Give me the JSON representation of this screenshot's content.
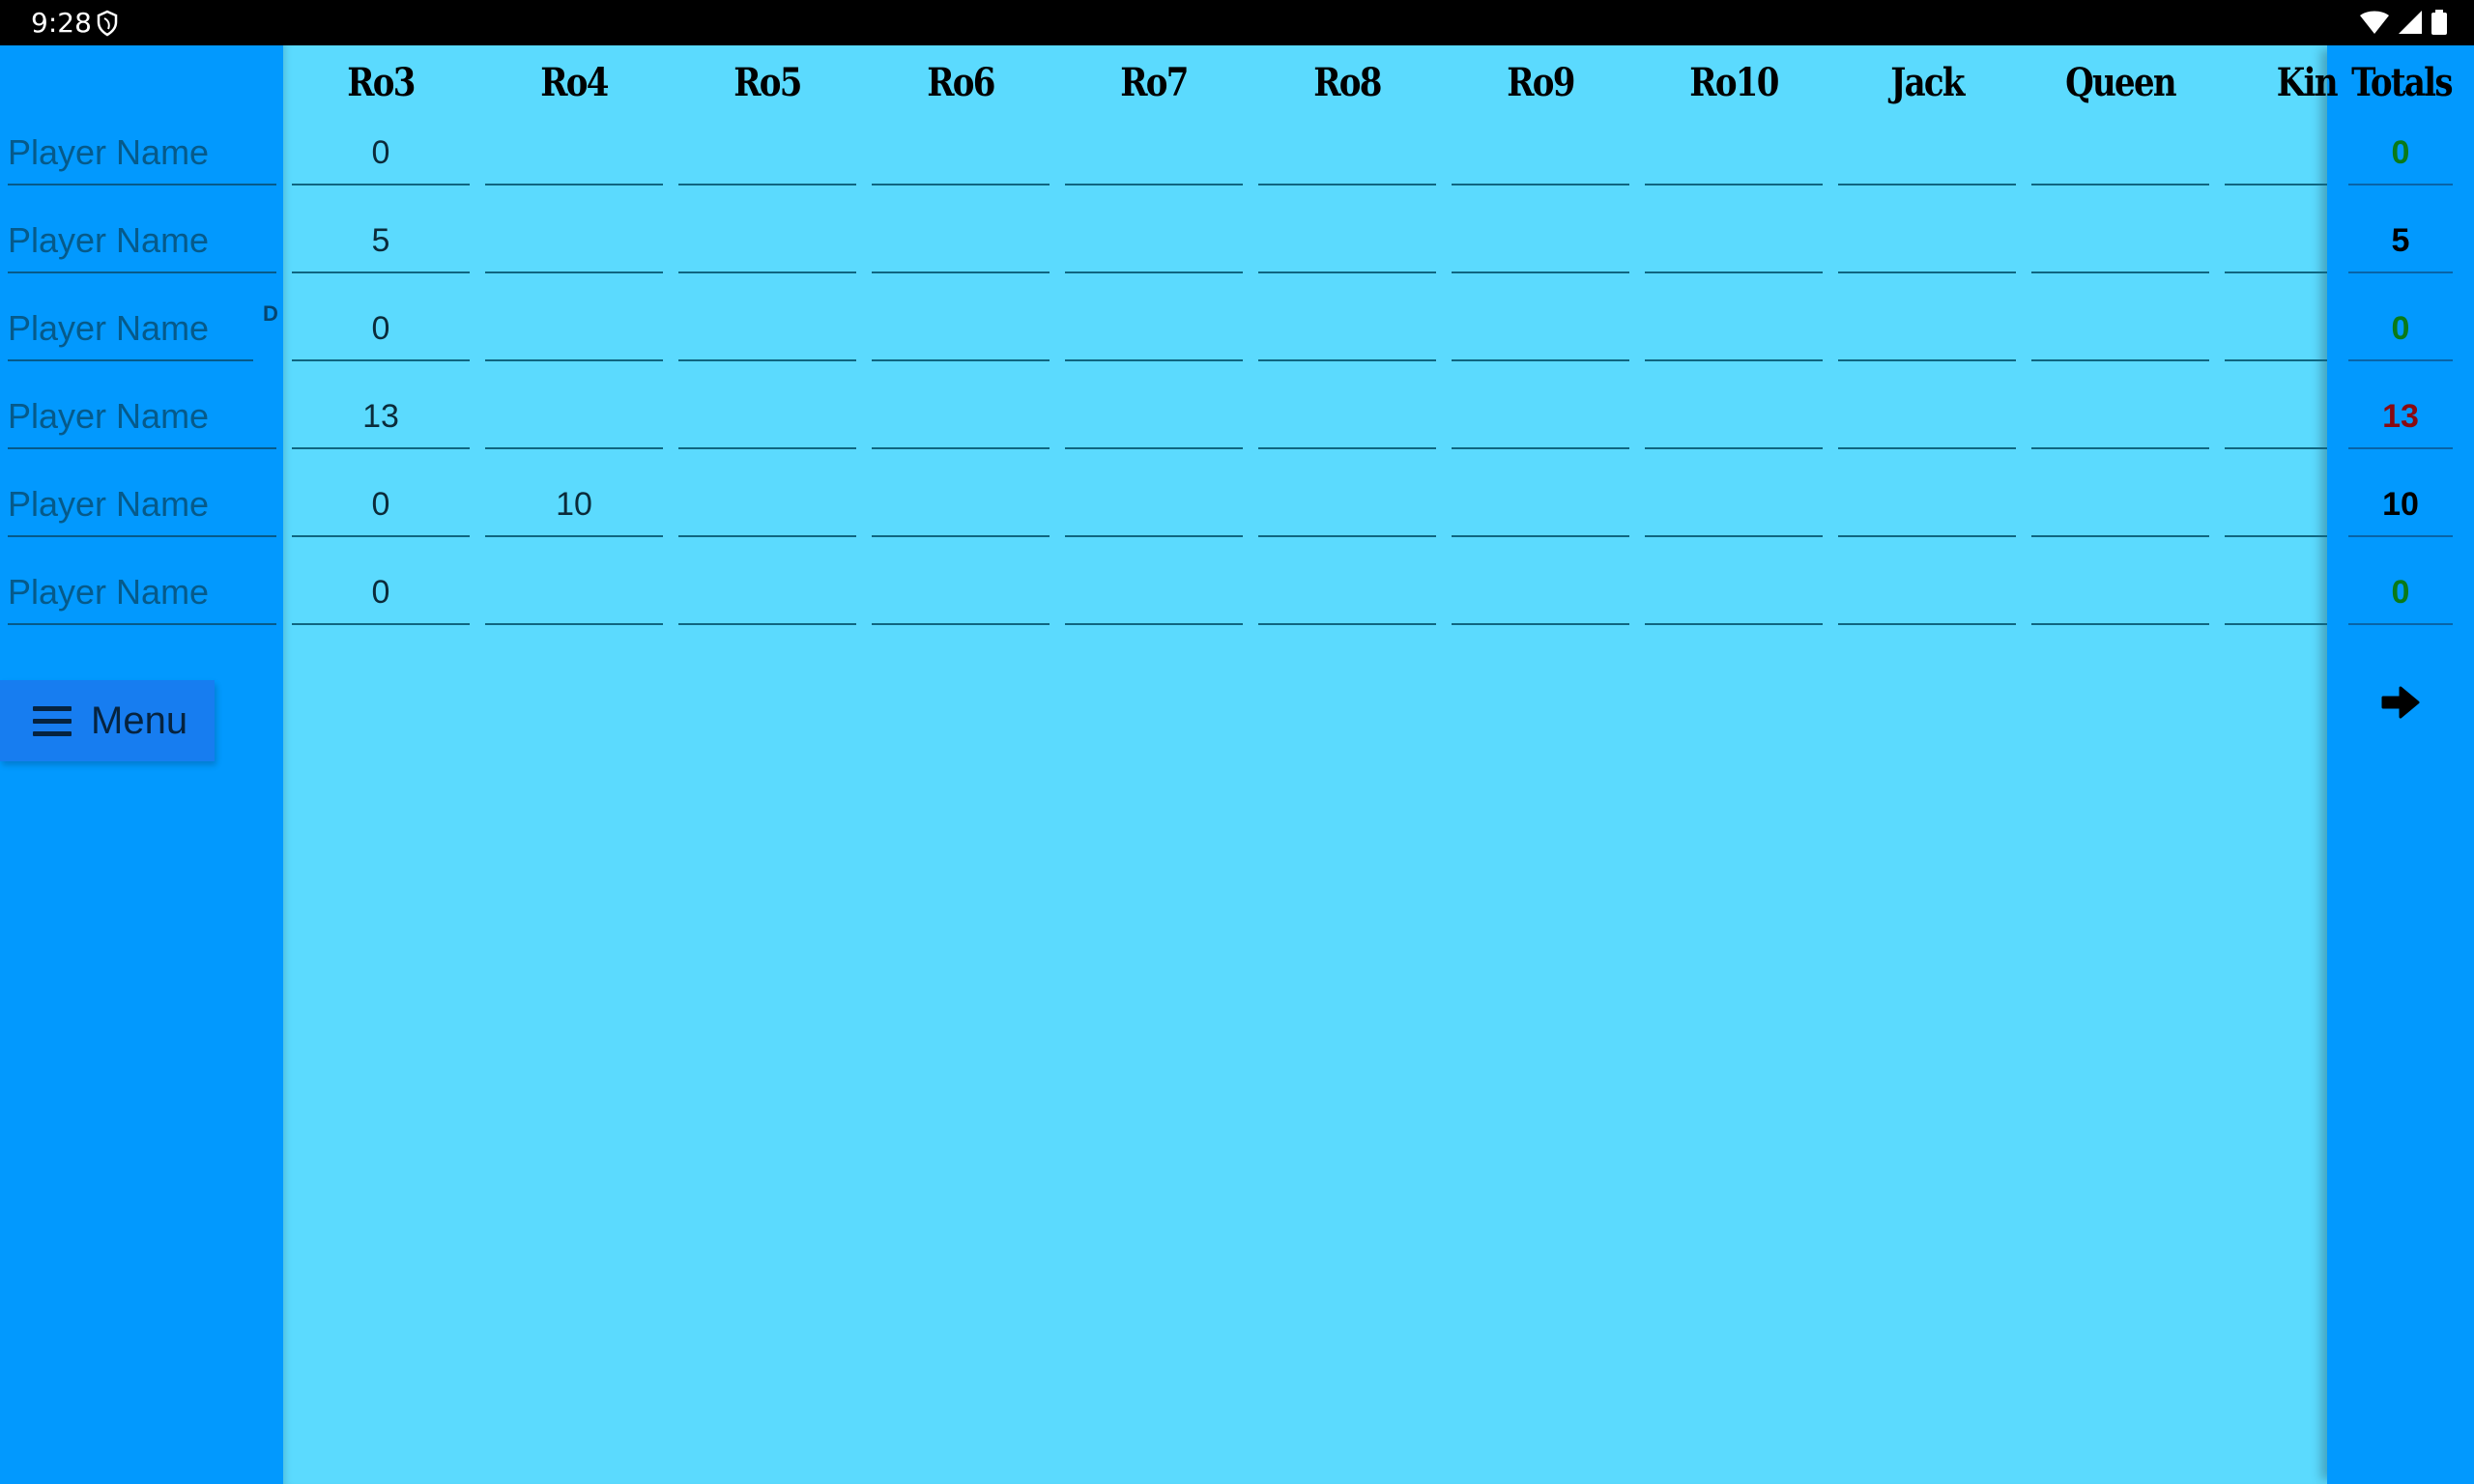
{
  "status_bar": {
    "time": "9:28",
    "icons": [
      "shield-icon",
      "wifi-icon",
      "signal-icon",
      "battery-icon"
    ]
  },
  "columns": [
    "Ro3",
    "Ro4",
    "Ro5",
    "Ro6",
    "Ro7",
    "Ro8",
    "Ro9",
    "Ro10",
    "Jack",
    "Queen",
    "Kin"
  ],
  "totals_header": "Totals",
  "dealer_marker": "D",
  "players": [
    {
      "name_placeholder": "Player Name",
      "scores": [
        "0",
        "",
        "",
        "",
        "",
        "",
        "",
        "",
        "",
        "",
        ""
      ],
      "total": "0",
      "total_color": "#0a7a18"
    },
    {
      "name_placeholder": "Player Name",
      "scores": [
        "5",
        "",
        "",
        "",
        "",
        "",
        "",
        "",
        "",
        "",
        ""
      ],
      "total": "5",
      "total_color": "#000000"
    },
    {
      "name_placeholder": "Player Name",
      "scores": [
        "0",
        "",
        "",
        "",
        "",
        "",
        "",
        "",
        "",
        "",
        ""
      ],
      "total": "0",
      "total_color": "#0a7a18",
      "dealer": true
    },
    {
      "name_placeholder": "Player Name",
      "scores": [
        "13",
        "",
        "",
        "",
        "",
        "",
        "",
        "",
        "",
        "",
        ""
      ],
      "total": "13",
      "total_color": "#8a0a10"
    },
    {
      "name_placeholder": "Player Name",
      "scores": [
        "0",
        "10",
        "",
        "",
        "",
        "",
        "",
        "",
        "",
        "",
        ""
      ],
      "total": "10",
      "total_color": "#000000"
    },
    {
      "name_placeholder": "Player Name",
      "scores": [
        "0",
        "",
        "",
        "",
        "",
        "",
        "",
        "",
        "",
        "",
        ""
      ],
      "total": "0",
      "total_color": "#0a7a18"
    }
  ],
  "menu_button": {
    "label": "Menu",
    "icon": "hamburger-icon"
  },
  "next_button": {
    "icon": "arrow-right-icon"
  },
  "colors": {
    "sidebar": "#0299fe",
    "main": "#5bdafe",
    "menu_button": "#177df0",
    "total_zero": "#0a7a18",
    "total_high": "#8a0a10"
  }
}
